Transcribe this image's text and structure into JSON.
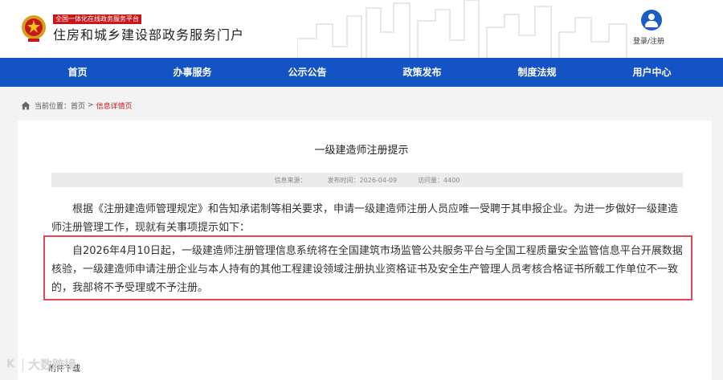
{
  "header": {
    "platform_tag": "全国一体化在线政务服务平台",
    "portal_title": "住房和城乡建设部政务服务门户",
    "login_label": "登录/注册"
  },
  "nav": {
    "items": [
      "首页",
      "办事服务",
      "公示公告",
      "政策发布",
      "制度法规",
      "用户中心"
    ]
  },
  "breadcrumb": {
    "prefix": "当前位置：",
    "home": "首页",
    "separator": ">",
    "current": "信息详情页"
  },
  "article": {
    "title": "一级建造师注册提示",
    "meta": {
      "source": "信息来源：",
      "publish_time": "发布时间：2026-04-09",
      "views": "访问量：4400"
    },
    "paragraph1": "根据《注册建造师管理规定》和告知承诺制等相关要求，申请一级建造师注册人员应唯一受聘于其申报企业。为进一步做好一级建造师注册管理工作，现就有关事项提示如下：",
    "paragraph2": "自2026年4月10日起，一级建造师注册管理信息系统将在全国建筑市场监管公共服务平台与全国工程质量安全监管信息平台开展数据核验，一级建造师申请注册企业与本人持有的其他工程建设领域注册执业资格证书及安全生产管理人员考核合格证书所载工作单位不一致的，我部将不予受理或不予注册。",
    "attachments_label": "附件下载"
  },
  "watermark": {
    "mark": "K",
    "text": "大数跨境"
  },
  "colors": {
    "nav_bg": "#1453c4",
    "accent_red": "#c8161d",
    "highlight_border": "#e0474f"
  }
}
